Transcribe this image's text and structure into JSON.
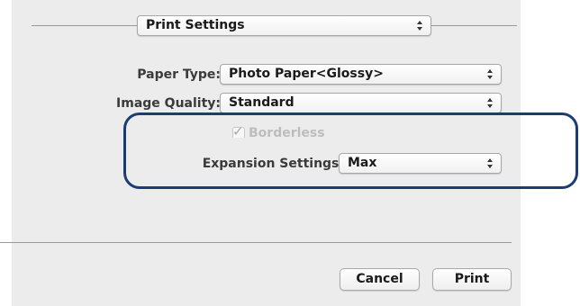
{
  "section_popup": {
    "value": "Print Settings"
  },
  "form": {
    "paper_type": {
      "label": "Paper Type:",
      "value": "Photo Paper<Glossy>"
    },
    "image_quality": {
      "label": "Image Quality:",
      "value": "Standard"
    },
    "borderless": {
      "label": "Borderless",
      "checked": true,
      "enabled": false
    },
    "expansion_settings": {
      "label": "Expansion Settings:",
      "value": "Max"
    }
  },
  "buttons": {
    "cancel": "Cancel",
    "print": "Print"
  },
  "colors": {
    "highlight": "#1b3d73",
    "panel_bg": "#ececec"
  }
}
